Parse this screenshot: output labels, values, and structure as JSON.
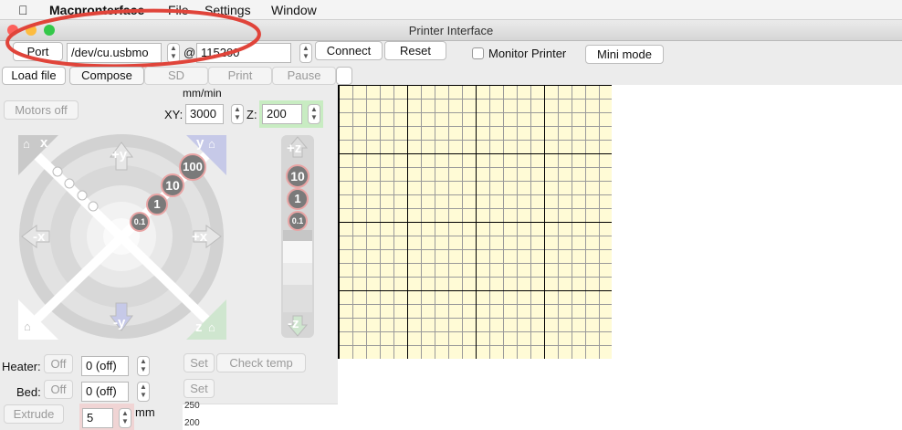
{
  "menubar": {
    "apple": "",
    "app_name": "Macpronterface",
    "items": [
      "File",
      "Settings",
      "Window"
    ]
  },
  "window": {
    "title": "Printer Interface"
  },
  "connection": {
    "port_button": "Port",
    "port_value": "/dev/cu.usbmo",
    "at_sign": "@",
    "baud_value": "115200",
    "connect_button": "Connect",
    "reset_button": "Reset",
    "monitor_label": "Monitor Printer",
    "mini_mode_button": "Mini mode"
  },
  "toolbar": {
    "load_file": "Load file",
    "compose": "Compose",
    "sd": "SD",
    "print": "Print",
    "pause": "Pause"
  },
  "controls": {
    "motors_off": "Motors off",
    "units": "mm/min",
    "xy_label": "XY:",
    "xy_value": "3000",
    "z_label": "Z:",
    "z_value": "200"
  },
  "jog": {
    "plus_y": "+y",
    "minus_y": "-y",
    "plus_x": "+x",
    "minus_x": "-x",
    "corner_x": "x",
    "corner_y": "y",
    "corner_z": "z",
    "steps": [
      "100",
      "10",
      "1",
      "0.1"
    ],
    "z_plus": "+z",
    "z_minus": "-z",
    "z_steps": [
      "10",
      "1",
      "0.1"
    ]
  },
  "temps": {
    "heater_label": "Heater:",
    "heater_button": "Off",
    "heater_value": "0 (off)",
    "bed_label": "Bed:",
    "bed_button": "Off",
    "bed_value": "0 (off)",
    "set1": "Set",
    "check_temp": "Check temp",
    "set2": "Set"
  },
  "extrude": {
    "button": "Extrude",
    "value": "5",
    "unit": "mm"
  },
  "graph": {
    "ticks": [
      "250",
      "200"
    ]
  },
  "annotation_color": "#e0443a"
}
